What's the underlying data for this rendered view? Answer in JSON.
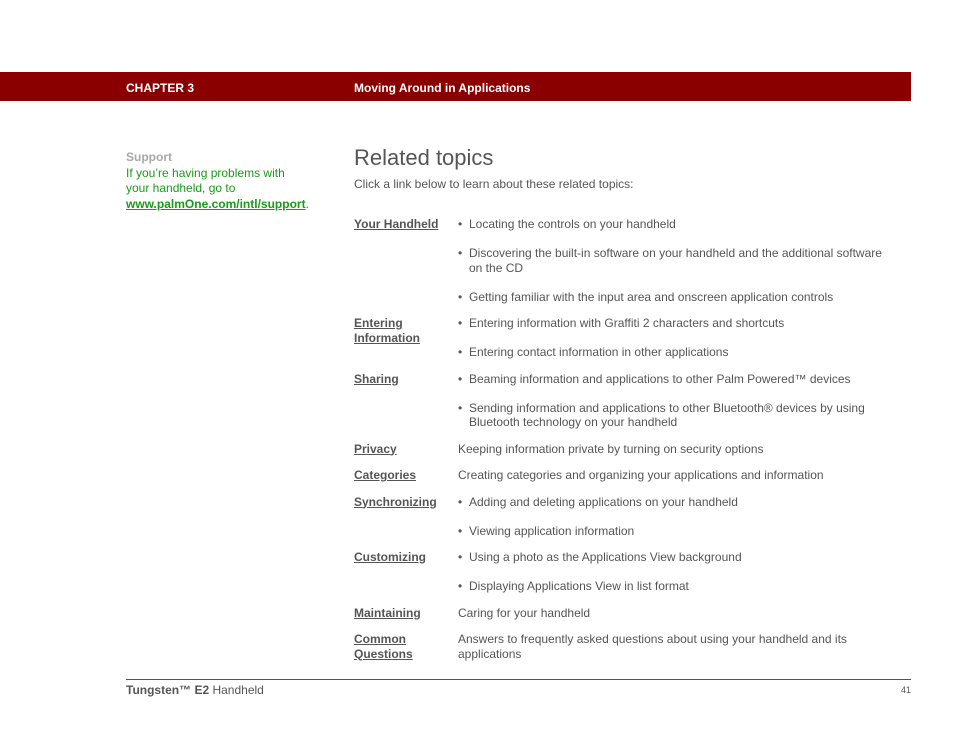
{
  "header": {
    "chapter": "CHAPTER 3",
    "title": "Moving Around in Applications",
    "background_color": "#8a0000"
  },
  "sidebar": {
    "title": "Support",
    "text": "If you’re having problems with your handheld, go to",
    "link_text": "www.palmOne.com/intl/support",
    "after_link": ".",
    "accent_color": "#1a9a1a"
  },
  "main": {
    "heading": "Related topics",
    "intro": "Click a link below to learn about these related topics:"
  },
  "topics": [
    {
      "label": "Your Handheld",
      "bullets": [
        "Locating the controls on your handheld",
        "Discovering the built-in software on your handheld and the additional software on the CD",
        "Getting familiar with the input area and onscreen application controls"
      ]
    },
    {
      "label": "Entering Information",
      "bullets": [
        "Entering information with Graffiti 2 characters and shortcuts",
        "Entering contact information in other applications"
      ]
    },
    {
      "label": "Sharing",
      "bullets": [
        "Beaming information and applications to other Palm Powered™  devices",
        "Sending information and applications to other Bluetooth® devices by using Bluetooth technology on your handheld"
      ]
    },
    {
      "label": "Privacy",
      "text": "Keeping information private by turning on security options"
    },
    {
      "label": "Categories",
      "text": "Creating categories and organizing your applications and information"
    },
    {
      "label": "Synchronizing",
      "bullets": [
        "Adding and deleting applications on your handheld",
        "Viewing application information"
      ]
    },
    {
      "label": "Customizing",
      "bullets": [
        "Using a photo as the Applications View background",
        "Displaying Applications View in list format"
      ]
    },
    {
      "label": "Maintaining",
      "text": "Caring for your handheld"
    },
    {
      "label": "Common Questions",
      "text": "Answers to frequently asked questions about using your handheld and its applications"
    }
  ],
  "footer": {
    "brand": "Tungsten™ E2",
    "product": " Handheld",
    "page_number": "41"
  }
}
